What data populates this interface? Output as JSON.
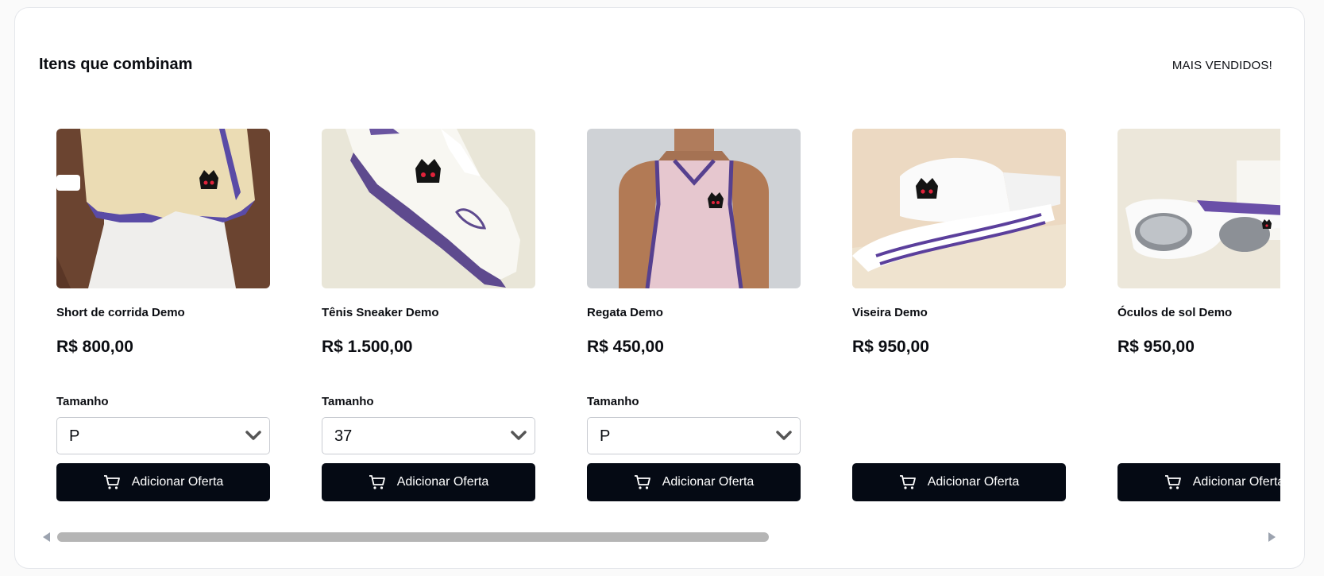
{
  "section": {
    "title": "Itens que combinam",
    "best_sellers_label": "MAIS VENDIDOS!"
  },
  "products": [
    {
      "name": "Short de corrida Demo",
      "price": "R$ 800,00",
      "size_label": "Tamanho",
      "size_value": "P",
      "button_label": "Adicionar Oferta"
    },
    {
      "name": "Tênis Sneaker Demo",
      "price": "R$ 1.500,00",
      "size_label": "Tamanho",
      "size_value": "37",
      "button_label": "Adicionar Oferta"
    },
    {
      "name": "Regata Demo",
      "price": "R$ 450,00",
      "size_label": "Tamanho",
      "size_value": "P",
      "button_label": "Adicionar Oferta"
    },
    {
      "name": "Viseira Demo",
      "price": "R$ 950,00",
      "button_label": "Adicionar Oferta"
    },
    {
      "name": "Óculos de sol Demo",
      "price": "R$ 950,00",
      "button_label": "Adicionar Oferta"
    }
  ],
  "icons": {
    "cart": "cart-icon",
    "chevron": "chevron-down-icon",
    "scroll_left": "scroll-left-arrow",
    "scroll_right": "scroll-right-arrow"
  },
  "colors": {
    "button_bg": "#050a14",
    "accent_purple": "#5b3f9c",
    "logo_red": "#e0233b"
  }
}
